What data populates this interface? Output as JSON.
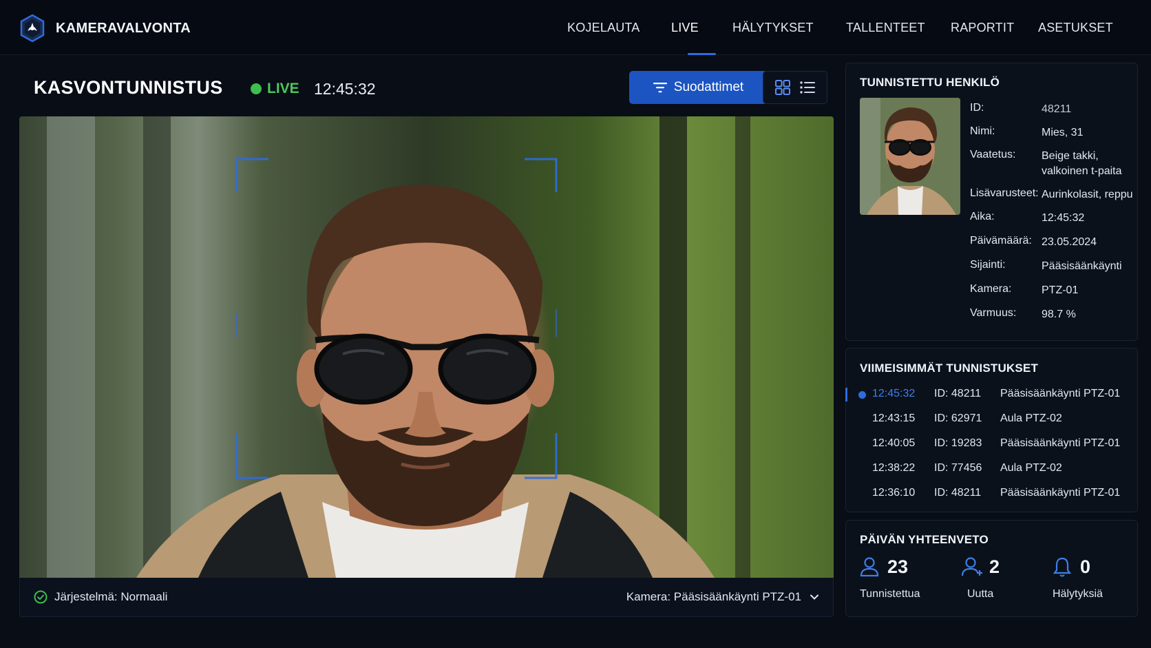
{
  "app": {
    "name": "KAMERAVALVONTA"
  },
  "nav": [
    {
      "label": "KOJELAUTA"
    },
    {
      "label": "LIVE"
    },
    {
      "label": "HÄLYTYKSET"
    },
    {
      "label": "TALLENTEET"
    },
    {
      "label": "RAPORTIT"
    },
    {
      "label": "ASETUKSET"
    }
  ],
  "nav_active": "LIVE",
  "header": {
    "title": "KASVONTUNNISTUS",
    "live_label": "LIVE",
    "time": "12:45:32",
    "filter_label": "Suodattimet"
  },
  "status": {
    "system": "Järjestelmä: Normaali",
    "camera": "Kamera: Pääsisäänkäynti PTZ-01"
  },
  "person": {
    "title": "TUNNISTETTU HENKILÖ",
    "rows": [
      {
        "key": "ID:",
        "value": "48211"
      },
      {
        "key": "Nimi:",
        "value": "Mies, 31"
      },
      {
        "key": "Vaatetus:",
        "value": "Beige takki,",
        "value2": "valkoinen t-paita"
      },
      {
        "key": "Lisävarusteet:",
        "value": "Aurinkolasit, reppu"
      },
      {
        "key": "Aika:",
        "value": "12:45:32"
      },
      {
        "key": "Päivämäärä:",
        "value": "23.05.2024"
      },
      {
        "key": "Sijainti:",
        "value": "Pääsisäänkäynti"
      },
      {
        "key": "Kamera:",
        "value": "PTZ-01"
      },
      {
        "key": "Varmuus:",
        "value": "98.7 %"
      }
    ]
  },
  "recent": {
    "title": "VIIMEISIMMÄT TUNNISTUKSET",
    "rows": [
      {
        "time": "12:45:32",
        "id": "ID: 48211",
        "location": "Pääsisäänkäynti PTZ-01"
      },
      {
        "time": "12:43:15",
        "id": "ID: 62971",
        "location": "Aula PTZ-02"
      },
      {
        "time": "12:40:05",
        "id": "ID: 19283",
        "location": "Pääsisäänkäynti PTZ-01"
      },
      {
        "time": "12:38:22",
        "id": "ID: 77456",
        "location": "Aula PTZ-02"
      },
      {
        "time": "12:36:10",
        "id": "ID: 48211",
        "location": "Pääsisäänkäynti PTZ-01"
      }
    ]
  },
  "summary": {
    "title": "PÄIVÄN YHTEENVETO",
    "stats": [
      {
        "value": "23",
        "label": "Tunnistettua",
        "icon": "user-icon"
      },
      {
        "value": "2",
        "label": "Uutta",
        "icon": "user-plus-icon"
      },
      {
        "value": "0",
        "label": "Hälytyksiä",
        "icon": "alert-icon"
      }
    ]
  },
  "colors": {
    "accent": "#2d6cdf",
    "live": "#3fbe4f",
    "background": "#080d16"
  }
}
